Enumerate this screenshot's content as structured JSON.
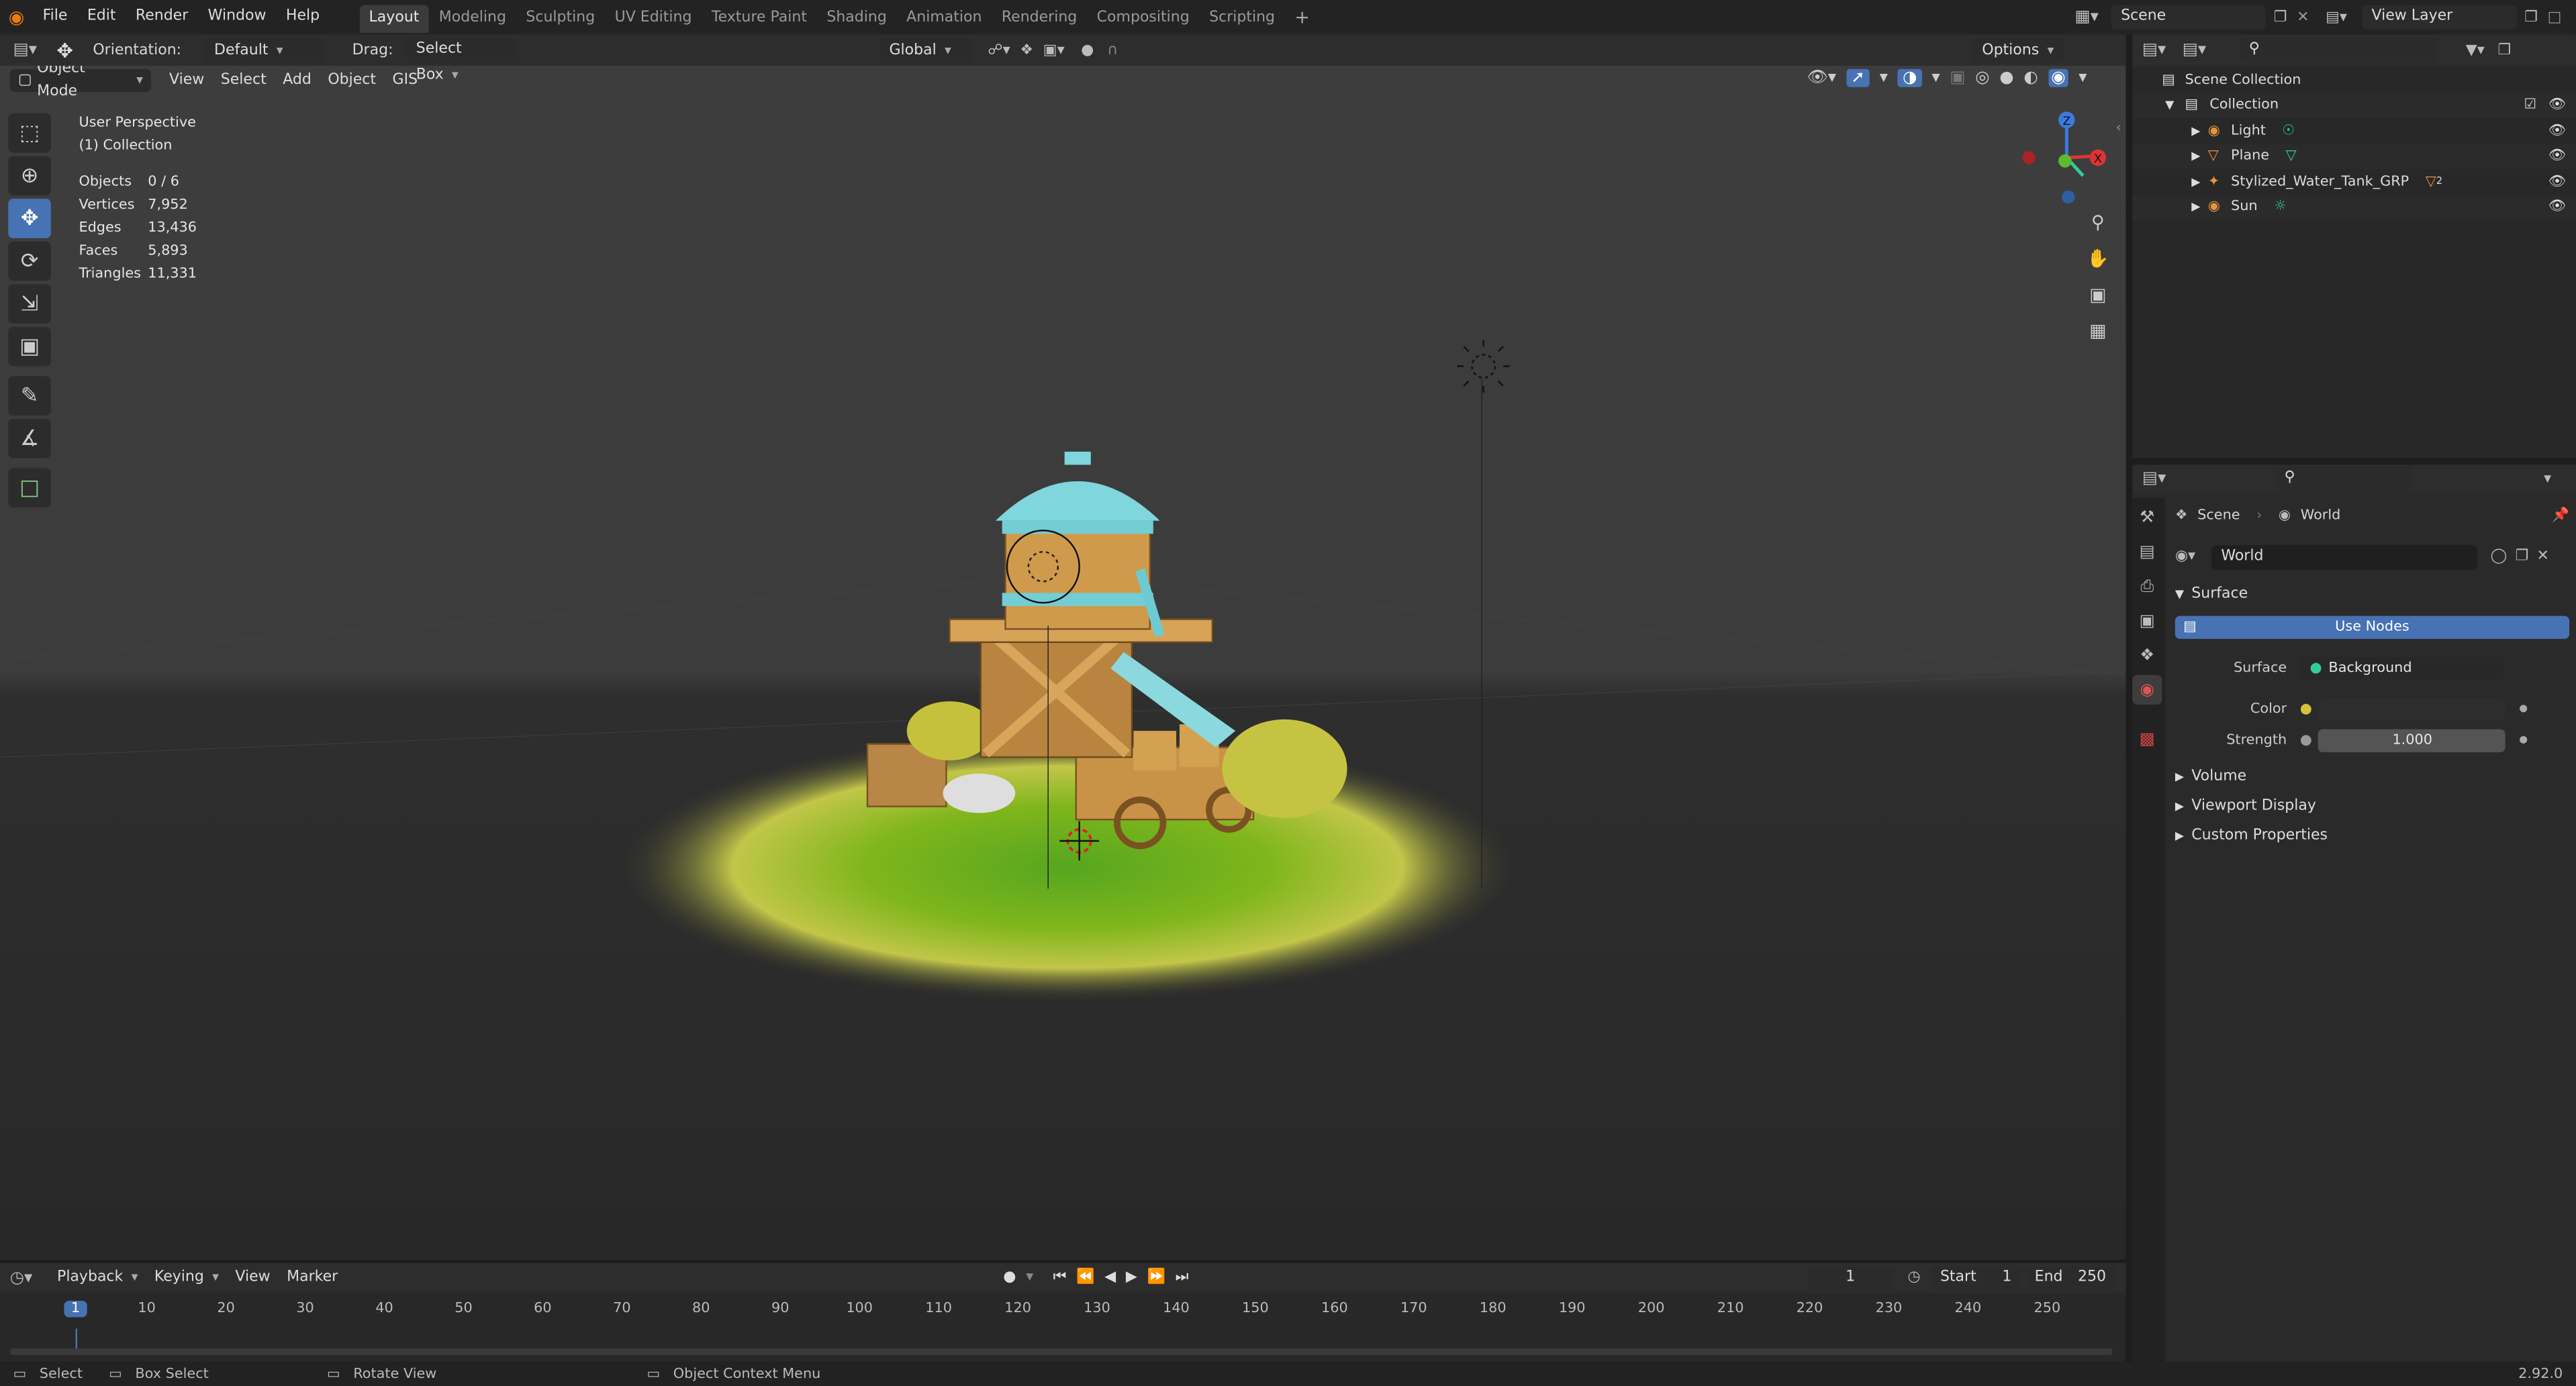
{
  "menu": [
    "File",
    "Edit",
    "Render",
    "Window",
    "Help"
  ],
  "workspaces": [
    "Layout",
    "Modeling",
    "Sculpting",
    "UV Editing",
    "Texture Paint",
    "Shading",
    "Animation",
    "Rendering",
    "Compositing",
    "Scripting"
  ],
  "scene_name": "Scene",
  "view_layer": "View Layer",
  "tool_header": {
    "orientation_label": "Orientation:",
    "orientation_value": "Default",
    "drag_label": "Drag:",
    "drag_value": "Select Box",
    "transform_orientation": "Global",
    "options": "Options"
  },
  "viewport_header": {
    "mode": "Object Mode",
    "menus": [
      "View",
      "Select",
      "Add",
      "Object",
      "GIS"
    ]
  },
  "overlay_text": {
    "perspective": "User Perspective",
    "collection": "(1) Collection",
    "stats": [
      {
        "label": "Objects",
        "value": "0 / 6"
      },
      {
        "label": "Vertices",
        "value": "7,952"
      },
      {
        "label": "Edges",
        "value": "13,436"
      },
      {
        "label": "Faces",
        "value": "5,893"
      },
      {
        "label": "Triangles",
        "value": "11,331"
      }
    ]
  },
  "gizmo": {
    "z": "Z",
    "x": "X"
  },
  "outliner": {
    "root": "Scene Collection",
    "collection": "Collection",
    "items": [
      "Light",
      "Plane",
      "Stylized_Water_Tank_GRP",
      "Sun"
    ],
    "tank_badge": "2"
  },
  "properties": {
    "breadcrumb_scene": "Scene",
    "breadcrumb_world": "World",
    "world_name": "World",
    "surface_panel": "Surface",
    "use_nodes": "Use Nodes",
    "surface_label": "Surface",
    "surface_value": "Background",
    "color_label": "Color",
    "strength_label": "Strength",
    "strength_value": "1.000",
    "panels": [
      "Volume",
      "Viewport Display",
      "Custom Properties"
    ]
  },
  "timeline": {
    "menus": [
      "Playback",
      "Keying",
      "View",
      "Marker"
    ],
    "current_frame": "1",
    "start_label": "Start",
    "start_value": "1",
    "end_label": "End",
    "end_value": "250",
    "ticks": [
      "1",
      "10",
      "20",
      "30",
      "40",
      "50",
      "60",
      "70",
      "80",
      "90",
      "100",
      "110",
      "120",
      "130",
      "140",
      "150",
      "160",
      "170",
      "180",
      "190",
      "200",
      "210",
      "220",
      "230",
      "240",
      "250"
    ]
  },
  "status": {
    "select": "Select",
    "box_select": "Box Select",
    "rotate_view": "Rotate View",
    "context_menu": "Object Context Menu",
    "version": "2.92.0"
  },
  "colors": {
    "accent": "#4772b3",
    "active_frame": "#4772b3",
    "background": "#1d1d1d"
  }
}
